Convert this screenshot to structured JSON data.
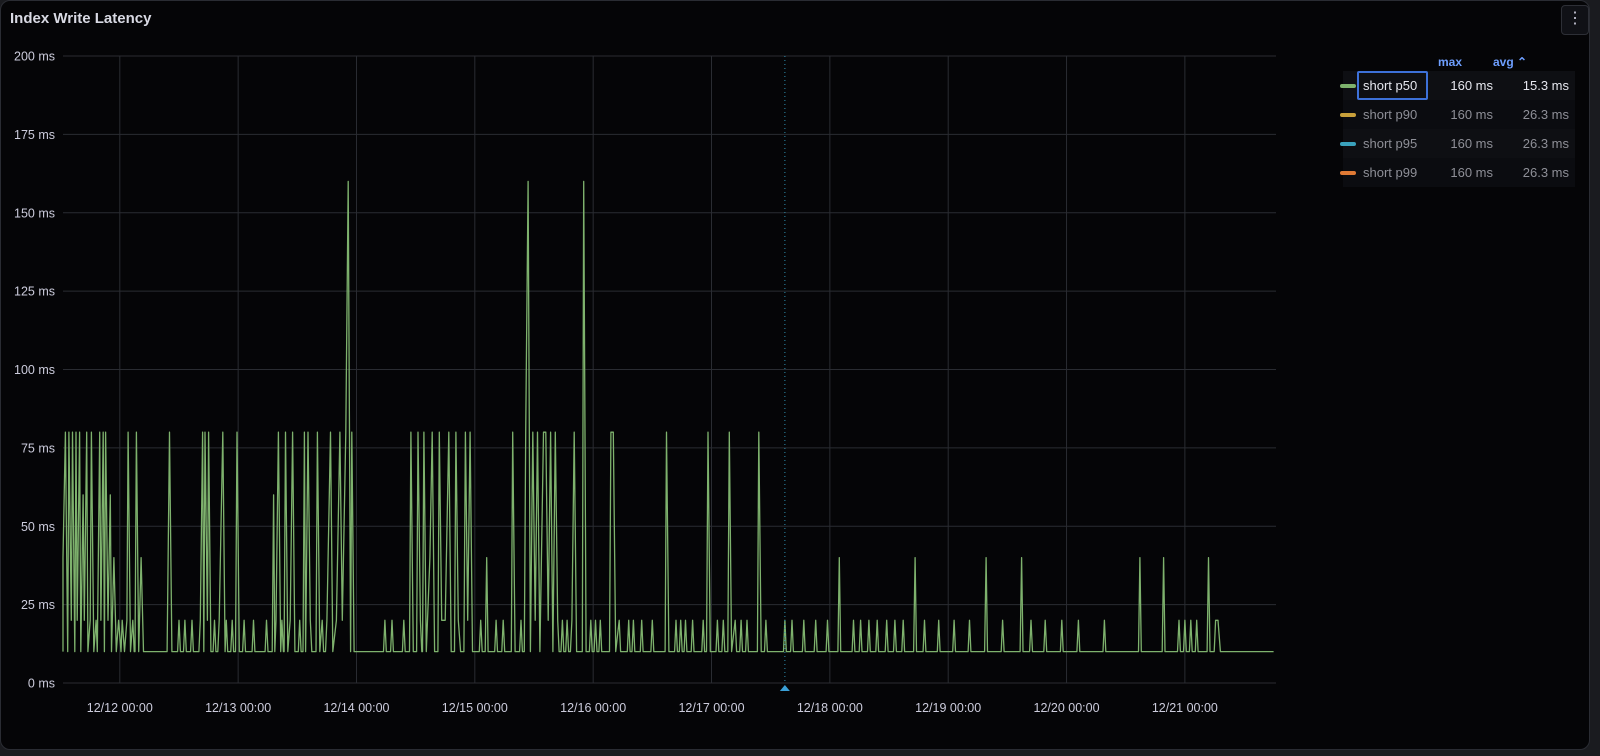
{
  "panel": {
    "title": "Index Write Latency",
    "menu_icon": "kebab-menu-icon"
  },
  "legend": {
    "headers": {
      "max": "max",
      "avg": "avg",
      "avg_sort_indicator": "⌃"
    },
    "items": [
      {
        "name": "short p50",
        "color": "#7eb26d",
        "max": "160 ms",
        "avg": "15.3 ms",
        "selected": true
      },
      {
        "name": "short p90",
        "color": "#c8a03a",
        "max": "160 ms",
        "avg": "26.3 ms",
        "selected": false
      },
      {
        "name": "short p95",
        "color": "#3aa2bd",
        "max": "160 ms",
        "avg": "26.3 ms",
        "selected": false
      },
      {
        "name": "short p99",
        "color": "#e07a35",
        "max": "160 ms",
        "avg": "26.3 ms",
        "selected": false
      }
    ]
  },
  "chart_data": {
    "type": "line",
    "y_ticks": [
      "0 ms",
      "25 ms",
      "50 ms",
      "75 ms",
      "100 ms",
      "125 ms",
      "150 ms",
      "175 ms",
      "200 ms"
    ],
    "ylim": [
      0,
      200
    ],
    "x_ticks": [
      "12/12 00:00",
      "12/13 00:00",
      "12/14 00:00",
      "12/15 00:00",
      "12/16 00:00",
      "12/17 00:00",
      "12/18 00:00",
      "12/19 00:00",
      "12/20 00:00",
      "12/21 00:00"
    ],
    "xlim_days": [
      11.52,
      21.77
    ],
    "grid": true,
    "annotation_marker_day": 17.62,
    "series": [
      {
        "name": "short p50",
        "color": "#7eb26d",
        "baseline": 10,
        "points": [
          [
            11.52,
            40
          ],
          [
            11.54,
            80
          ],
          [
            11.56,
            10
          ],
          [
            11.57,
            80
          ],
          [
            11.59,
            20
          ],
          [
            11.6,
            80
          ],
          [
            11.62,
            10
          ],
          [
            11.63,
            80
          ],
          [
            11.64,
            20
          ],
          [
            11.66,
            80
          ],
          [
            11.67,
            10
          ],
          [
            11.69,
            60
          ],
          [
            11.7,
            20
          ],
          [
            11.72,
            80
          ],
          [
            11.73,
            10
          ],
          [
            11.75,
            20
          ],
          [
            11.76,
            80
          ],
          [
            11.78,
            10
          ],
          [
            11.8,
            20
          ],
          [
            11.81,
            10
          ],
          [
            11.83,
            80
          ],
          [
            11.84,
            20
          ],
          [
            11.86,
            80
          ],
          [
            11.87,
            10
          ],
          [
            11.88,
            80
          ],
          [
            11.9,
            20
          ],
          [
            11.92,
            60
          ],
          [
            11.93,
            10
          ],
          [
            11.95,
            40
          ],
          [
            11.97,
            10
          ],
          [
            11.99,
            20
          ],
          [
            12.01,
            10
          ],
          [
            12.02,
            20
          ],
          [
            12.04,
            10
          ],
          [
            12.06,
            20
          ],
          [
            12.07,
            80
          ],
          [
            12.09,
            10
          ],
          [
            12.11,
            20
          ],
          [
            12.14,
            80
          ],
          [
            12.16,
            10
          ],
          [
            12.18,
            40
          ],
          [
            12.2,
            10
          ],
          [
            12.4,
            10
          ],
          [
            12.42,
            80
          ],
          [
            12.44,
            10
          ],
          [
            12.5,
            20
          ],
          [
            12.55,
            20
          ],
          [
            12.61,
            20
          ],
          [
            12.68,
            20
          ],
          [
            12.7,
            80
          ],
          [
            12.71,
            10
          ],
          [
            12.72,
            80
          ],
          [
            12.74,
            20
          ],
          [
            12.75,
            80
          ],
          [
            12.77,
            10
          ],
          [
            12.8,
            20
          ],
          [
            12.84,
            20
          ],
          [
            12.87,
            80
          ],
          [
            12.89,
            10
          ],
          [
            12.9,
            20
          ],
          [
            12.95,
            20
          ],
          [
            12.99,
            80
          ],
          [
            13.01,
            10
          ],
          [
            13.05,
            20
          ],
          [
            13.13,
            20
          ],
          [
            13.24,
            20
          ],
          [
            13.3,
            60
          ],
          [
            13.31,
            10
          ],
          [
            13.32,
            20
          ],
          [
            13.34,
            80
          ],
          [
            13.36,
            10
          ],
          [
            13.37,
            20
          ],
          [
            13.4,
            80
          ],
          [
            13.42,
            10
          ],
          [
            13.44,
            20
          ],
          [
            13.46,
            80
          ],
          [
            13.48,
            10
          ],
          [
            13.52,
            20
          ],
          [
            13.56,
            80
          ],
          [
            13.57,
            10
          ],
          [
            13.59,
            80
          ],
          [
            13.61,
            20
          ],
          [
            13.67,
            80
          ],
          [
            13.69,
            10
          ],
          [
            13.71,
            20
          ],
          [
            13.75,
            20
          ],
          [
            13.78,
            80
          ],
          [
            13.8,
            10
          ],
          [
            13.83,
            20
          ],
          [
            13.86,
            80
          ],
          [
            13.88,
            20
          ],
          [
            13.91,
            80
          ],
          [
            13.93,
            160
          ],
          [
            13.95,
            10
          ],
          [
            13.96,
            80
          ],
          [
            13.98,
            10
          ],
          [
            14.24,
            20
          ],
          [
            14.3,
            20
          ],
          [
            14.4,
            20
          ],
          [
            14.46,
            80
          ],
          [
            14.48,
            10
          ],
          [
            14.52,
            80
          ],
          [
            14.54,
            20
          ],
          [
            14.57,
            80
          ],
          [
            14.59,
            10
          ],
          [
            14.62,
            40
          ],
          [
            14.64,
            80
          ],
          [
            14.66,
            10
          ],
          [
            14.7,
            80
          ],
          [
            14.72,
            20
          ],
          [
            14.75,
            20
          ],
          [
            14.78,
            80
          ],
          [
            14.8,
            10
          ],
          [
            14.84,
            80
          ],
          [
            14.86,
            20
          ],
          [
            14.88,
            10
          ],
          [
            14.92,
            80
          ],
          [
            14.94,
            20
          ],
          [
            14.96,
            80
          ],
          [
            14.98,
            10
          ],
          [
            15.05,
            20
          ],
          [
            15.1,
            40
          ],
          [
            15.18,
            20
          ],
          [
            15.24,
            20
          ],
          [
            15.32,
            80
          ],
          [
            15.34,
            10
          ],
          [
            15.39,
            20
          ],
          [
            15.43,
            80
          ],
          [
            15.45,
            160
          ],
          [
            15.47,
            10
          ],
          [
            15.49,
            80
          ],
          [
            15.51,
            20
          ],
          [
            15.53,
            80
          ],
          [
            15.55,
            10
          ],
          [
            15.58,
            80
          ],
          [
            15.6,
            80
          ],
          [
            15.62,
            20
          ],
          [
            15.64,
            80
          ],
          [
            15.66,
            10
          ],
          [
            15.68,
            80
          ],
          [
            15.7,
            20
          ],
          [
            15.74,
            20
          ],
          [
            15.78,
            20
          ],
          [
            15.82,
            20
          ],
          [
            15.84,
            80
          ],
          [
            15.86,
            10
          ],
          [
            15.92,
            160
          ],
          [
            15.94,
            10
          ],
          [
            15.98,
            20
          ],
          [
            16.02,
            20
          ],
          [
            16.06,
            20
          ],
          [
            16.15,
            80
          ],
          [
            16.17,
            80
          ],
          [
            16.19,
            10
          ],
          [
            16.22,
            20
          ],
          [
            16.3,
            20
          ],
          [
            16.34,
            20
          ],
          [
            16.41,
            20
          ],
          [
            16.5,
            20
          ],
          [
            16.62,
            80
          ],
          [
            16.64,
            10
          ],
          [
            16.7,
            20
          ],
          [
            16.74,
            20
          ],
          [
            16.78,
            20
          ],
          [
            16.84,
            20
          ],
          [
            16.93,
            20
          ],
          [
            16.97,
            80
          ],
          [
            16.99,
            10
          ],
          [
            17.05,
            20
          ],
          [
            17.1,
            20
          ],
          [
            17.15,
            80
          ],
          [
            17.17,
            10
          ],
          [
            17.2,
            20
          ],
          [
            17.25,
            20
          ],
          [
            17.3,
            20
          ],
          [
            17.4,
            80
          ],
          [
            17.42,
            10
          ],
          [
            17.46,
            20
          ],
          [
            17.62,
            20
          ],
          [
            17.68,
            20
          ],
          [
            17.78,
            20
          ],
          [
            17.88,
            20
          ],
          [
            17.98,
            20
          ],
          [
            18.08,
            40
          ],
          [
            18.2,
            20
          ],
          [
            18.26,
            20
          ],
          [
            18.33,
            20
          ],
          [
            18.4,
            20
          ],
          [
            18.48,
            20
          ],
          [
            18.55,
            20
          ],
          [
            18.62,
            20
          ],
          [
            18.72,
            40
          ],
          [
            18.8,
            20
          ],
          [
            18.92,
            20
          ],
          [
            19.05,
            20
          ],
          [
            19.18,
            20
          ],
          [
            19.32,
            40
          ],
          [
            19.46,
            20
          ],
          [
            19.62,
            40
          ],
          [
            19.7,
            20
          ],
          [
            19.82,
            20
          ],
          [
            19.96,
            20
          ],
          [
            20.1,
            20
          ],
          [
            20.32,
            20
          ],
          [
            20.62,
            40
          ],
          [
            20.82,
            40
          ],
          [
            20.95,
            20
          ],
          [
            21.0,
            20
          ],
          [
            21.05,
            20
          ],
          [
            21.1,
            20
          ],
          [
            21.2,
            40
          ],
          [
            21.26,
            20
          ],
          [
            21.28,
            20
          ],
          [
            21.3,
            10
          ]
        ]
      }
    ]
  }
}
